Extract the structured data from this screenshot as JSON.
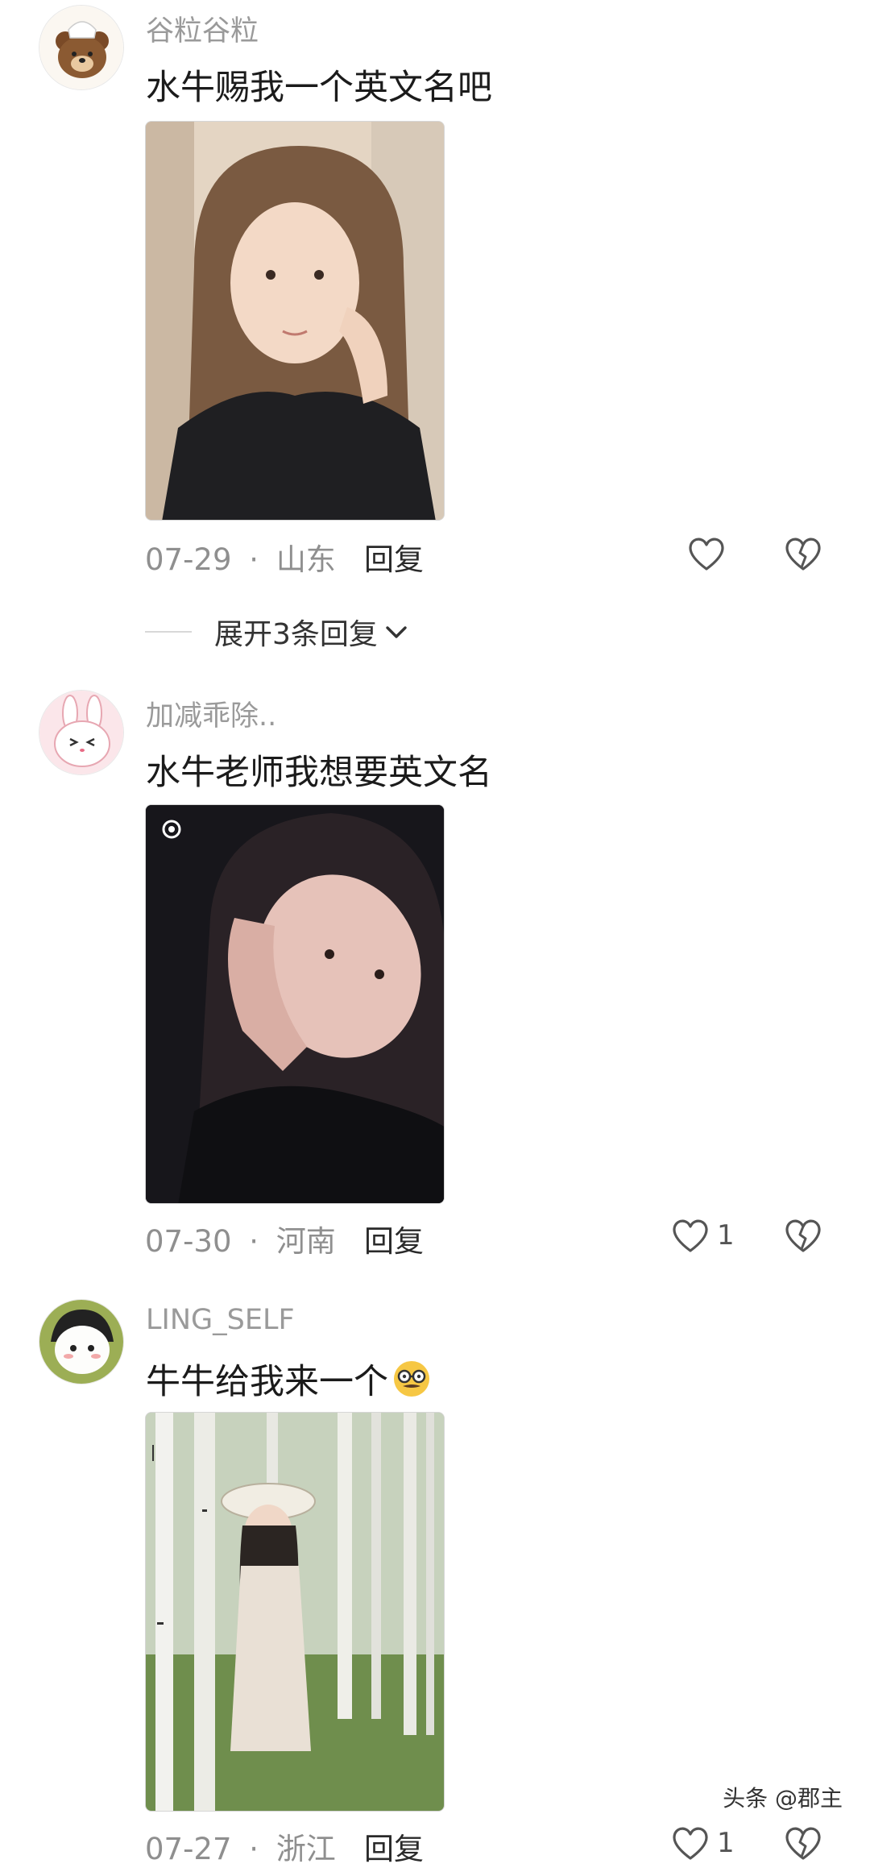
{
  "comments": [
    {
      "username": "谷粒谷粒",
      "text": "水牛赐我一个英文名吧",
      "date": "07-29",
      "sep": "·",
      "location": "山东",
      "reply_label": "回复",
      "like_count": ""
    },
    {
      "username": "加减乖除..",
      "text": "水牛老师我想要英文名",
      "date": "07-30",
      "sep": "·",
      "location": "河南",
      "reply_label": "回复",
      "like_count": "1"
    },
    {
      "username": "LING_SELF",
      "text": "牛牛给我来一个",
      "emoji": "🥸",
      "date": "07-27",
      "sep": "·",
      "location": "浙江",
      "reply_label": "回复",
      "like_count": "1"
    }
  ],
  "expand_replies": {
    "label": "展开3条回复",
    "chevron_icon": "chevron-down-icon"
  },
  "icons": {
    "like": "heart-outline-icon",
    "dislike": "broken-heart-icon"
  },
  "watermark": "头条 @郡主",
  "colors": {
    "username": "#9a9a9a",
    "meta": "#8f8f8f",
    "text": "#1b1b1b"
  }
}
